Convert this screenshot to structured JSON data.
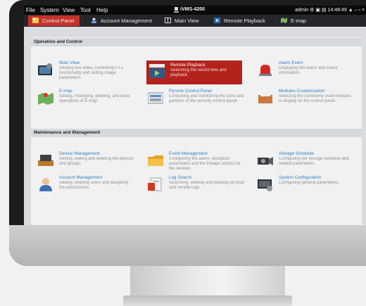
{
  "titlebar": {
    "menu": [
      "File",
      "System",
      "View",
      "Tool",
      "Help"
    ],
    "app_title": "iVMS-4200",
    "user": "admin",
    "clock": "14:48:49"
  },
  "tabs": [
    {
      "label": "Control Panel"
    },
    {
      "label": "Account Management"
    },
    {
      "label": "Main View"
    },
    {
      "label": "Remote Playback"
    },
    {
      "label": "E-map"
    }
  ],
  "sections": [
    {
      "title": "Operation and Control",
      "modules": [
        {
          "title": "Main View",
          "desc": "Viewing live video, controlling PTZ functionality and setting image parameters."
        },
        {
          "title": "Remote Playback",
          "desc": "Searching the record files and playback."
        },
        {
          "title": "Alarm Event",
          "desc": "Displaying the Alarm and Event information."
        },
        {
          "title": "E-map",
          "desc": "Adding, modifying, deleting, and basic operations of E-map."
        },
        {
          "title": "Pyronix Control Panel",
          "desc": "Controlling and monitoring the zone and partition of the security control panel."
        },
        {
          "title": "Modules Customization",
          "desc": "Selecting the commonly used modules to display on the control panel."
        }
      ]
    },
    {
      "title": "Maintenance and Management",
      "modules": [
        {
          "title": "Device Management",
          "desc": "Adding, editing and deleting the devices and groups."
        },
        {
          "title": "Event Management",
          "desc": "Configuring the alarm, exception parameters and the linkage actions for the devices."
        },
        {
          "title": "Storage Schedule",
          "desc": "Configuring the storage schedule and related parameters."
        },
        {
          "title": "Account Management",
          "desc": "Adding, deleting users and assigning the permissions."
        },
        {
          "title": "Log Search",
          "desc": "Searching, viewing and backing up local and remote logs."
        },
        {
          "title": "System Configuration",
          "desc": "Configuring general parameters."
        }
      ]
    }
  ],
  "colors": {
    "accent_red": "#b3231c",
    "tab_active": "#c3322b",
    "title_blue": "#2f80c4"
  }
}
